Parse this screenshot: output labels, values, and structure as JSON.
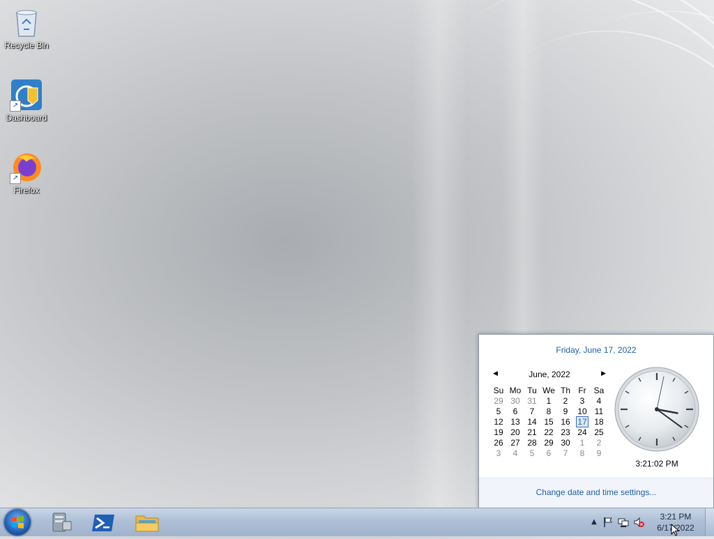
{
  "desktop": {
    "icons": [
      {
        "label": "Recycle Bin",
        "icon": "recycle-bin-icon"
      },
      {
        "label": "Dashboard",
        "icon": "dashboard-icon"
      },
      {
        "label": "Firefox",
        "icon": "firefox-icon"
      }
    ]
  },
  "taskbar": {
    "start": "windows-start-orb",
    "pinned": [
      "server-manager-icon",
      "powershell-icon",
      "file-explorer-icon"
    ],
    "tray": [
      "show-hidden-icons-arrow",
      "action-center-flag-icon",
      "network-icon",
      "volume-muted-icon"
    ],
    "clock": {
      "time": "3:21 PM",
      "date": "6/17/2022"
    }
  },
  "clock_popup": {
    "long_date": "Friday, June 17, 2022",
    "month_label": "June, 2022",
    "weekdays": [
      "Su",
      "Mo",
      "Tu",
      "We",
      "Th",
      "Fr",
      "Sa"
    ],
    "weeks": [
      [
        [
          "29",
          true
        ],
        [
          "30",
          true
        ],
        [
          "31",
          true
        ],
        [
          "1",
          false
        ],
        [
          "2",
          false
        ],
        [
          "3",
          false
        ],
        [
          "4",
          false
        ]
      ],
      [
        [
          "5",
          false
        ],
        [
          "6",
          false
        ],
        [
          "7",
          false
        ],
        [
          "8",
          false
        ],
        [
          "9",
          false
        ],
        [
          "10",
          false
        ],
        [
          "11",
          false
        ]
      ],
      [
        [
          "12",
          false
        ],
        [
          "13",
          false
        ],
        [
          "14",
          false
        ],
        [
          "15",
          false
        ],
        [
          "16",
          false
        ],
        [
          "17",
          false
        ],
        [
          "18",
          false
        ]
      ],
      [
        [
          "19",
          false
        ],
        [
          "20",
          false
        ],
        [
          "21",
          false
        ],
        [
          "22",
          false
        ],
        [
          "23",
          false
        ],
        [
          "24",
          false
        ],
        [
          "25",
          false
        ]
      ],
      [
        [
          "26",
          false
        ],
        [
          "27",
          false
        ],
        [
          "28",
          false
        ],
        [
          "29",
          false
        ],
        [
          "30",
          false
        ],
        [
          "1",
          true
        ],
        [
          "2",
          true
        ]
      ],
      [
        [
          "3",
          true
        ],
        [
          "4",
          true
        ],
        [
          "5",
          true
        ],
        [
          "6",
          true
        ],
        [
          "7",
          true
        ],
        [
          "8",
          true
        ],
        [
          "9",
          true
        ]
      ]
    ],
    "today": "17",
    "digital_time": "3:21:02 PM",
    "analog": {
      "hour": 3,
      "minute": 21,
      "second": 2
    },
    "footer_link": "Change date and time settings..."
  },
  "colors": {
    "link": "#1e5ea8",
    "taskbar": "#aebfd6"
  }
}
